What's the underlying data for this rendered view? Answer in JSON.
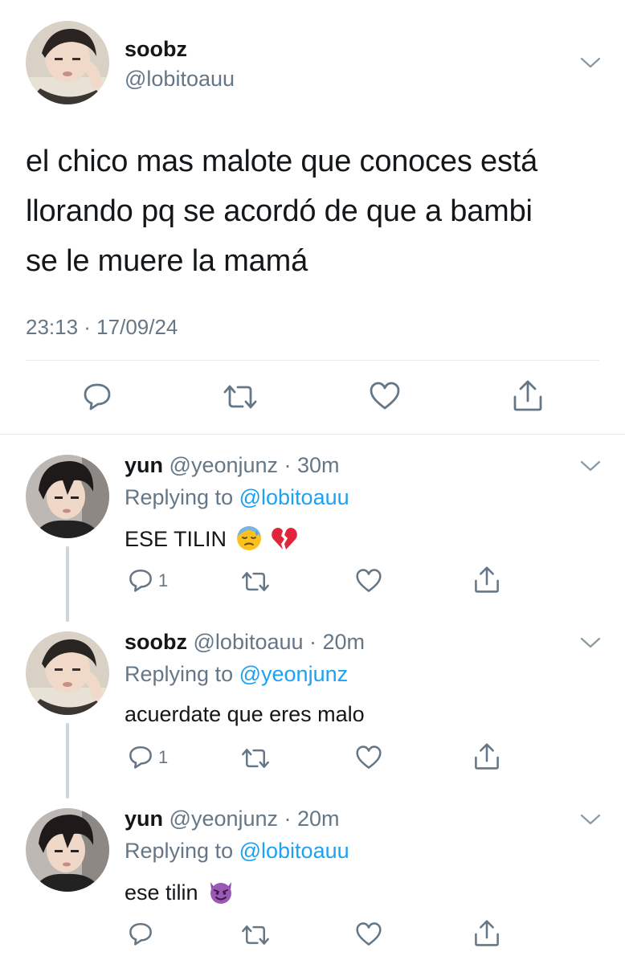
{
  "main_tweet": {
    "display_name": "soobz",
    "handle": "@lobitoauu",
    "text_lines": [
      "el chico mas malote que conoces está",
      "llorando pq se acordó de que a bambi",
      "se le muere la mamá"
    ],
    "timestamp": "23:13 · 17/09/24"
  },
  "replies": [
    {
      "display_name": "yun",
      "meta": "@yeonjunz · 30m",
      "replying_prefix": "Replying to",
      "replying_to": "@lobitoauu",
      "text": "ESE TILIN",
      "emojis": [
        "downcast-sweat-face-emoji",
        "broken-heart-emoji"
      ],
      "reply_count": "1"
    },
    {
      "display_name": "soobz",
      "meta": "@lobitoauu · 20m",
      "replying_prefix": "Replying to",
      "replying_to": "@yeonjunz",
      "text": "acuerdate que eres malo",
      "emojis": [],
      "reply_count": "1"
    },
    {
      "display_name": "yun",
      "meta": "@yeonjunz · 20m",
      "replying_prefix": "Replying to",
      "replying_to": "@lobitoauu",
      "text": "ese tilin",
      "emojis": [
        "smiling-devil-emoji"
      ],
      "reply_count": ""
    }
  ],
  "colors": {
    "link": "#1da1f2",
    "muted": "#657786",
    "icon": "#657786",
    "divider": "#e6ecf0",
    "thread_line": "#ccd6dd"
  }
}
